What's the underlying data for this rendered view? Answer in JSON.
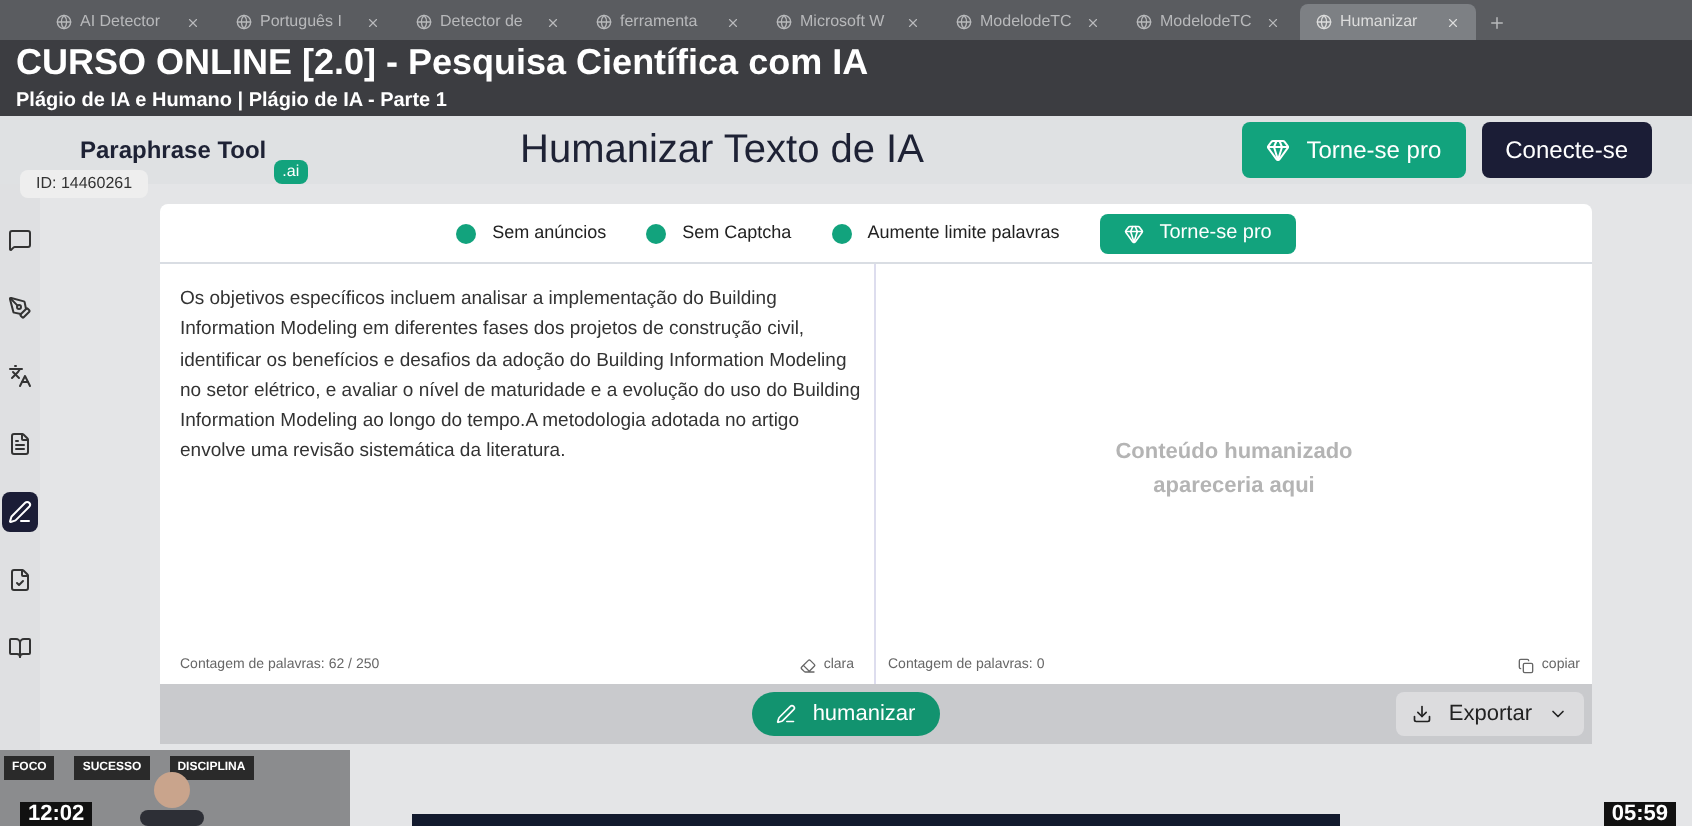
{
  "browser_tabs": [
    {
      "title": "AI Detector",
      "selected": false
    },
    {
      "title": "Português I",
      "selected": false
    },
    {
      "title": "Detector de",
      "selected": false
    },
    {
      "title": "ferramenta",
      "selected": false
    },
    {
      "title": "Microsoft W",
      "selected": false
    },
    {
      "title": "ModelodeTC",
      "selected": false
    },
    {
      "title": "ModelodeTC",
      "selected": false
    },
    {
      "title": "Humanizar",
      "selected": true
    }
  ],
  "video_overlay": {
    "title": "CURSO ONLINE [2.0] - Pesquisa Científica com IA",
    "subtitle": "Plágio de IA e Humano | Plágio de IA - Parte 1",
    "id_badge": "ID: 14460261",
    "time_left": "12:02",
    "time_right": "05:59",
    "webcam_signs": [
      "FOCO",
      "SUCESSO",
      "DISCIPLINA"
    ]
  },
  "header": {
    "logo": "Paraphrase Tool",
    "logo_suffix": ".ai",
    "title": "Humanizar Texto de IA",
    "pro_button": "Torne-se pro",
    "connect_button": "Conecte-se"
  },
  "sidebar": {
    "items": [
      {
        "selected": false
      },
      {
        "selected": false
      },
      {
        "selected": false
      },
      {
        "selected": false
      },
      {
        "selected": true
      },
      {
        "selected": false
      },
      {
        "selected": false
      }
    ]
  },
  "features": [
    "Sem anúncios",
    "Sem Captcha",
    "Aumente limite palavras"
  ],
  "feature_pro_button": "Torne-se pro",
  "input": {
    "text": "Os objetivos específicos incluem analisar a implementação do Building Information Modeling em diferentes fases dos projetos de construção civil, identificar os benefícios e desafios da adoção do Building Information Modeling no setor elétrico, e avaliar o nível de maturidade e a evolução do uso do Building Information Modeling ao longo do tempo.A metodologia adotada no artigo envolve uma revisão sistemática da literatura.",
    "word_count": "Contagem de palavras: 62 / 250",
    "clear": "clara"
  },
  "output": {
    "placeholder": "Conteúdo humanizado apareceria aqui",
    "word_count": "Contagem de palavras: 0",
    "copy": "copiar"
  },
  "humanize_button": "humanizar",
  "export_button": "Exportar"
}
